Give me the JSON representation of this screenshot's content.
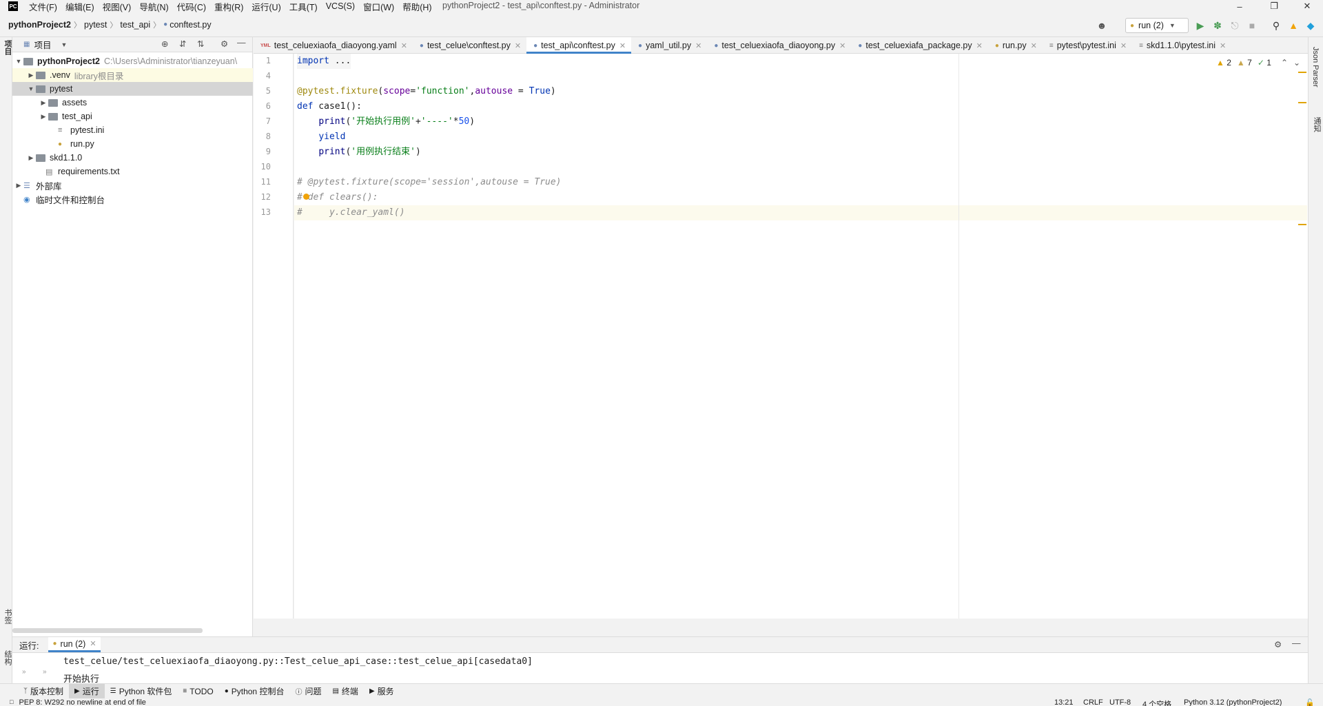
{
  "menubar": {
    "logo": "PC",
    "items": [
      "文件(F)",
      "编辑(E)",
      "视图(V)",
      "导航(N)",
      "代码(C)",
      "重构(R)",
      "运行(U)",
      "工具(T)",
      "VCS(S)",
      "窗口(W)",
      "帮助(H)"
    ],
    "window_title": "pythonProject2 - test_api\\conftest.py - Administrator"
  },
  "breadcrumb": [
    "pythonProject2",
    "pytest",
    "test_api",
    "conftest.py"
  ],
  "toolbar": {
    "run_config": "run (2)"
  },
  "left_stripe": {
    "project": "项目",
    "bookmarks": "书签",
    "structure": "结构"
  },
  "right_stripe": {
    "json_parser": "Json Parser",
    "notifications": "通知"
  },
  "project_panel": {
    "title": "项目",
    "tree": [
      {
        "label": "pythonProject2",
        "hint": "C:\\Users\\Administrator\\tianzeyuan\\",
        "type": "folder",
        "expanded": true
      },
      {
        "label": ".venv",
        "hint": "library根目录",
        "type": "folder",
        "expanded": false
      },
      {
        "label": "pytest",
        "hint": "",
        "type": "folder",
        "expanded": true
      },
      {
        "label": "assets",
        "hint": "",
        "type": "folder",
        "expanded": false
      },
      {
        "label": "test_api",
        "hint": "",
        "type": "folder",
        "expanded": false
      },
      {
        "label": "pytest.ini",
        "hint": "",
        "type": "file"
      },
      {
        "label": "run.py",
        "hint": "",
        "type": "file"
      },
      {
        "label": "skd1.1.0",
        "hint": "",
        "type": "folder",
        "expanded": false
      },
      {
        "label": "requirements.txt",
        "hint": "",
        "type": "file"
      },
      {
        "label": "外部库",
        "hint": "",
        "type": "lib",
        "expanded": false
      },
      {
        "label": "临时文件和控制台",
        "hint": "",
        "type": "scratch"
      }
    ]
  },
  "editor": {
    "tabs": [
      {
        "label": "test_celuexiaofa_diaoyong.yaml",
        "icon": "YML"
      },
      {
        "label": "test_celue\\conftest.py",
        "icon": "py"
      },
      {
        "label": "test_api\\conftest.py",
        "icon": "py"
      },
      {
        "label": "yaml_util.py",
        "icon": "py"
      },
      {
        "label": "test_celuexiaofa_diaoyong.py",
        "icon": "py"
      },
      {
        "label": "test_celuexiafa_package.py",
        "icon": "py"
      },
      {
        "label": "run.py",
        "icon": "py"
      },
      {
        "label": "pytest\\pytest.ini",
        "icon": "ini"
      },
      {
        "label": "skd1.1.0\\pytest.ini",
        "icon": "ini"
      }
    ],
    "line_numbers": [
      "1",
      "4",
      "5",
      "6",
      "7",
      "8",
      "9",
      "10",
      "11",
      "12",
      "13"
    ],
    "code_lines": [
      "import ...",
      "",
      "@pytest.fixture(scope='function',autouse = True)",
      "def case1():",
      "    print('开始执行用例'+'----'*50)",
      "    yield",
      "    print('用例执行结束')",
      "",
      "# @pytest.fixture(scope='session',autouse = True)",
      "# def clears():",
      "#     y.clear_yaml()"
    ],
    "inspections": {
      "warnings": "2",
      "weak_warnings": "7",
      "ok": "1"
    }
  },
  "run_panel": {
    "label": "运行:",
    "tab": "run (2)",
    "output": [
      "test_celue/test_celuexiaofa_diaoyong.py::Test_celue_api_case::test_celue_api[casedata0]",
      "开始执行"
    ]
  },
  "tool_strip": [
    "版本控制",
    "运行",
    "Python 软件包",
    "TODO",
    "Python 控制台",
    "问题",
    "终端",
    "服务"
  ],
  "status_bar": {
    "message": "PEP 8: W292 no newline at end of file",
    "position": "13:21",
    "line_sep": "CRLF",
    "encoding": "UTF-8",
    "indent": "4 个空格",
    "interpreter": "Python 3.12 (pythonProject2)"
  }
}
